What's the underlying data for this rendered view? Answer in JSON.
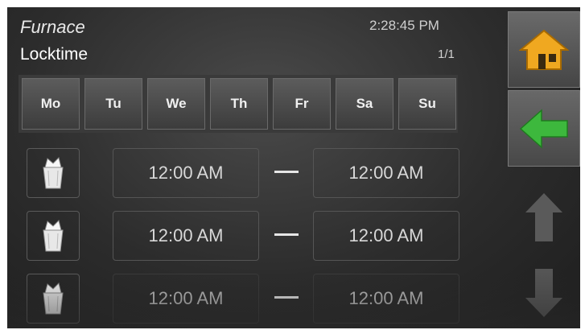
{
  "header": {
    "title": "Furnace",
    "subtitle": "Locktime",
    "clock": "2:28:45 PM",
    "page": "1/1"
  },
  "days": [
    "Mo",
    "Tu",
    "We",
    "Th",
    "Fr",
    "Sa",
    "Su"
  ],
  "schedule": [
    {
      "start": "12:00 AM",
      "end": "12:00 AM",
      "icon": "bin-icon"
    },
    {
      "start": "12:00 AM",
      "end": "12:00 AM",
      "icon": "bin-icon"
    },
    {
      "start": "12:00 AM",
      "end": "12:00 AM",
      "icon": "bin-icon"
    }
  ],
  "sidebar": {
    "home_icon": "home-icon",
    "back_icon": "back-arrow-icon",
    "up_icon": "arrow-up-icon",
    "down_icon": "arrow-down-icon"
  },
  "colors": {
    "home_accent": "#f0a820",
    "back_accent": "#3db83d",
    "disabled_arrow": "#5a5a5a"
  }
}
